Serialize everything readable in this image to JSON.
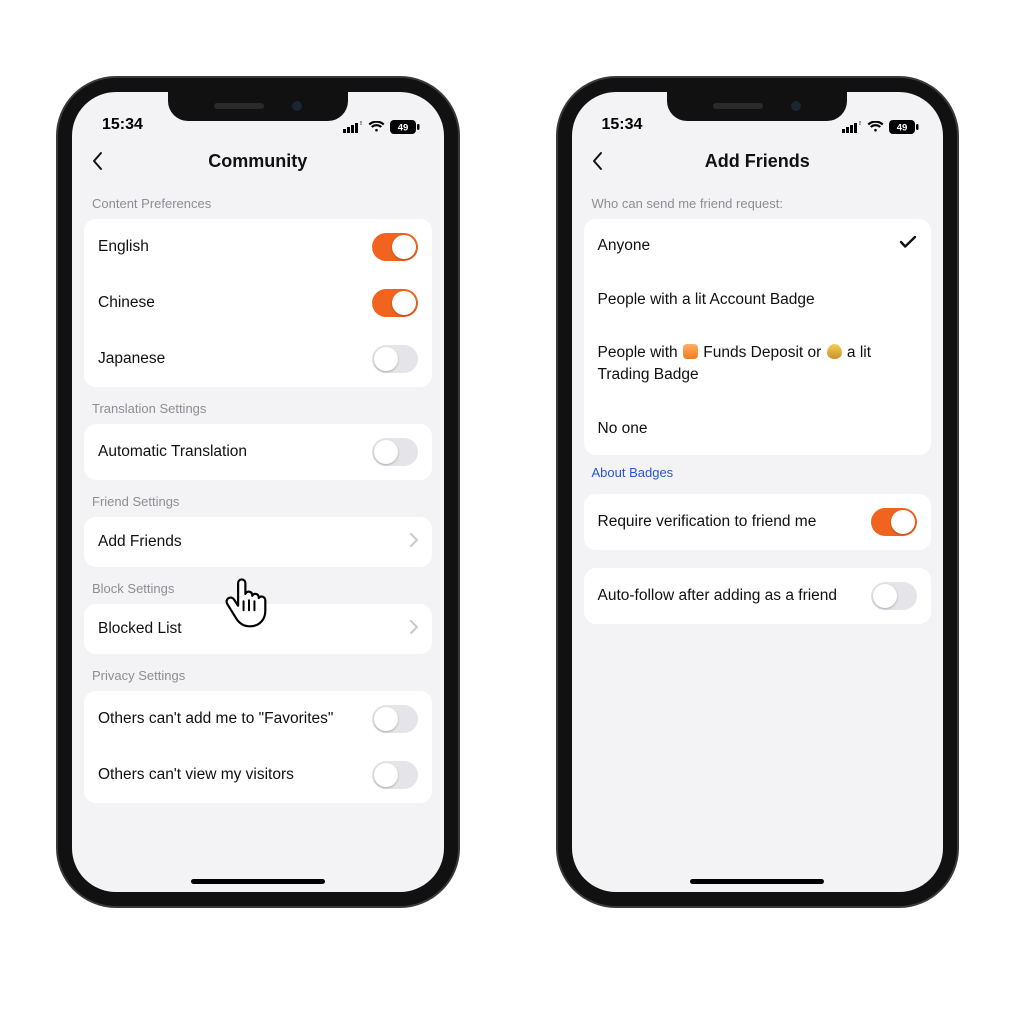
{
  "status": {
    "time": "15:34",
    "battery": "49"
  },
  "left": {
    "title": "Community",
    "sections": {
      "content_pref": {
        "header": "Content Preferences",
        "english": "English",
        "chinese": "Chinese",
        "japanese": "Japanese"
      },
      "translation": {
        "header": "Translation Settings",
        "auto": "Automatic Translation"
      },
      "friend": {
        "header": "Friend Settings",
        "add_friends": "Add Friends"
      },
      "block": {
        "header": "Block Settings",
        "blocked_list": "Blocked List"
      },
      "privacy": {
        "header": "Privacy Settings",
        "no_favorites": "Others can't add me to \"Favorites\"",
        "no_visitors": "Others can't view my visitors"
      }
    }
  },
  "right": {
    "title": "Add Friends",
    "subheader": "Who can send me friend request:",
    "options": {
      "anyone": "Anyone",
      "lit_account_badge": "People with a lit Account Badge",
      "funds_pre": "People with ",
      "funds_mid": " Funds Deposit or ",
      "funds_post": " a lit Trading Badge",
      "noone": "No one"
    },
    "about_badges": "About Badges",
    "require_verification": "Require verification to friend me",
    "auto_follow": "Auto-follow after adding as a friend"
  }
}
